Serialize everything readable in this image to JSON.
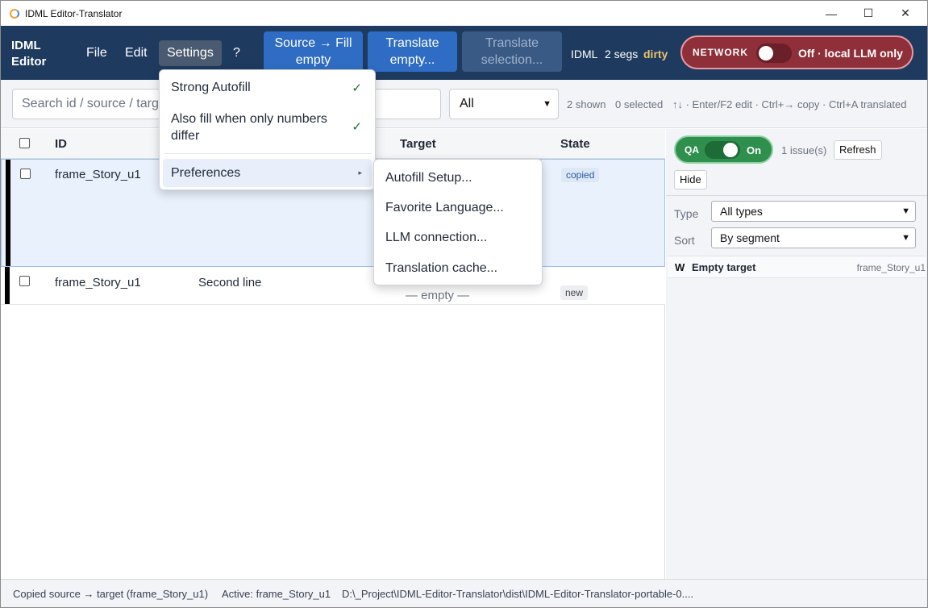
{
  "window": {
    "title": "IDML Editor-Translator",
    "minimize": "—",
    "maximize": "☐",
    "close": "✕"
  },
  "toolbar": {
    "brand_line1": "IDML",
    "brand_line2": "Editor",
    "menus": [
      "File",
      "Edit",
      "Settings",
      "?"
    ],
    "source_fill_line1": "Source → Fill",
    "source_fill_line2": "empty",
    "translate_empty_line1": "Translate",
    "translate_empty_line2": "empty...",
    "translate_selection_line1": "Translate",
    "translate_selection_line2": "selection...",
    "status_idml": "IDML",
    "status_segs": "2 segs",
    "status_dirty": "dirty",
    "network_label": "NETWORK",
    "network_state": "Off · local LLM only"
  },
  "search": {
    "placeholder": "Search id / source / target",
    "filter_value": "All",
    "shown": "2 shown",
    "selected": "0 selected",
    "hints": "↑↓ · Enter/F2 edit · Ctrl+→ copy · Ctrl+A translated"
  },
  "table": {
    "headers": {
      "id": "ID",
      "target": "Target",
      "state": "State"
    },
    "rows": [
      {
        "id": "frame_Story_u1",
        "source": "",
        "target": "",
        "state": "copied"
      },
      {
        "id": "frame_Story_u1",
        "source": "Second line",
        "target": "— empty —",
        "state": "new"
      }
    ]
  },
  "qa_panel": {
    "qa_label": "QA",
    "qa_state": "On",
    "issues": "1 issue(s)",
    "refresh": "Refresh",
    "hide": "Hide",
    "type_label": "Type",
    "type_value": "All types",
    "sort_label": "Sort",
    "sort_value": "By segment",
    "issue": {
      "severity": "W",
      "title": "Empty target",
      "id": "frame_Story_u1"
    }
  },
  "statusbar": {
    "message": "Copied source → target (frame_Story_u1)",
    "active": "Active: frame_Story_u1",
    "path": "D:\\_Project\\IDML-Editor-Translator\\dist\\IDML-Editor-Translator-portable-0...."
  },
  "settings_menu": {
    "strong_autofill": "Strong Autofill",
    "numbers_line1": "Also fill when only numbers",
    "numbers_line2": "differ",
    "preferences": "Preferences",
    "checkmark": "✓"
  },
  "preferences_submenu": [
    "Autofill Setup...",
    "Favorite Language...",
    "LLM connection...",
    "Translation cache..."
  ],
  "colors": {
    "toolbar": "#1e3a5f",
    "button": "#2f6dc4",
    "network": "#8f2f3a",
    "qa": "#2f8f4d",
    "dirty": "#e9c46a"
  }
}
